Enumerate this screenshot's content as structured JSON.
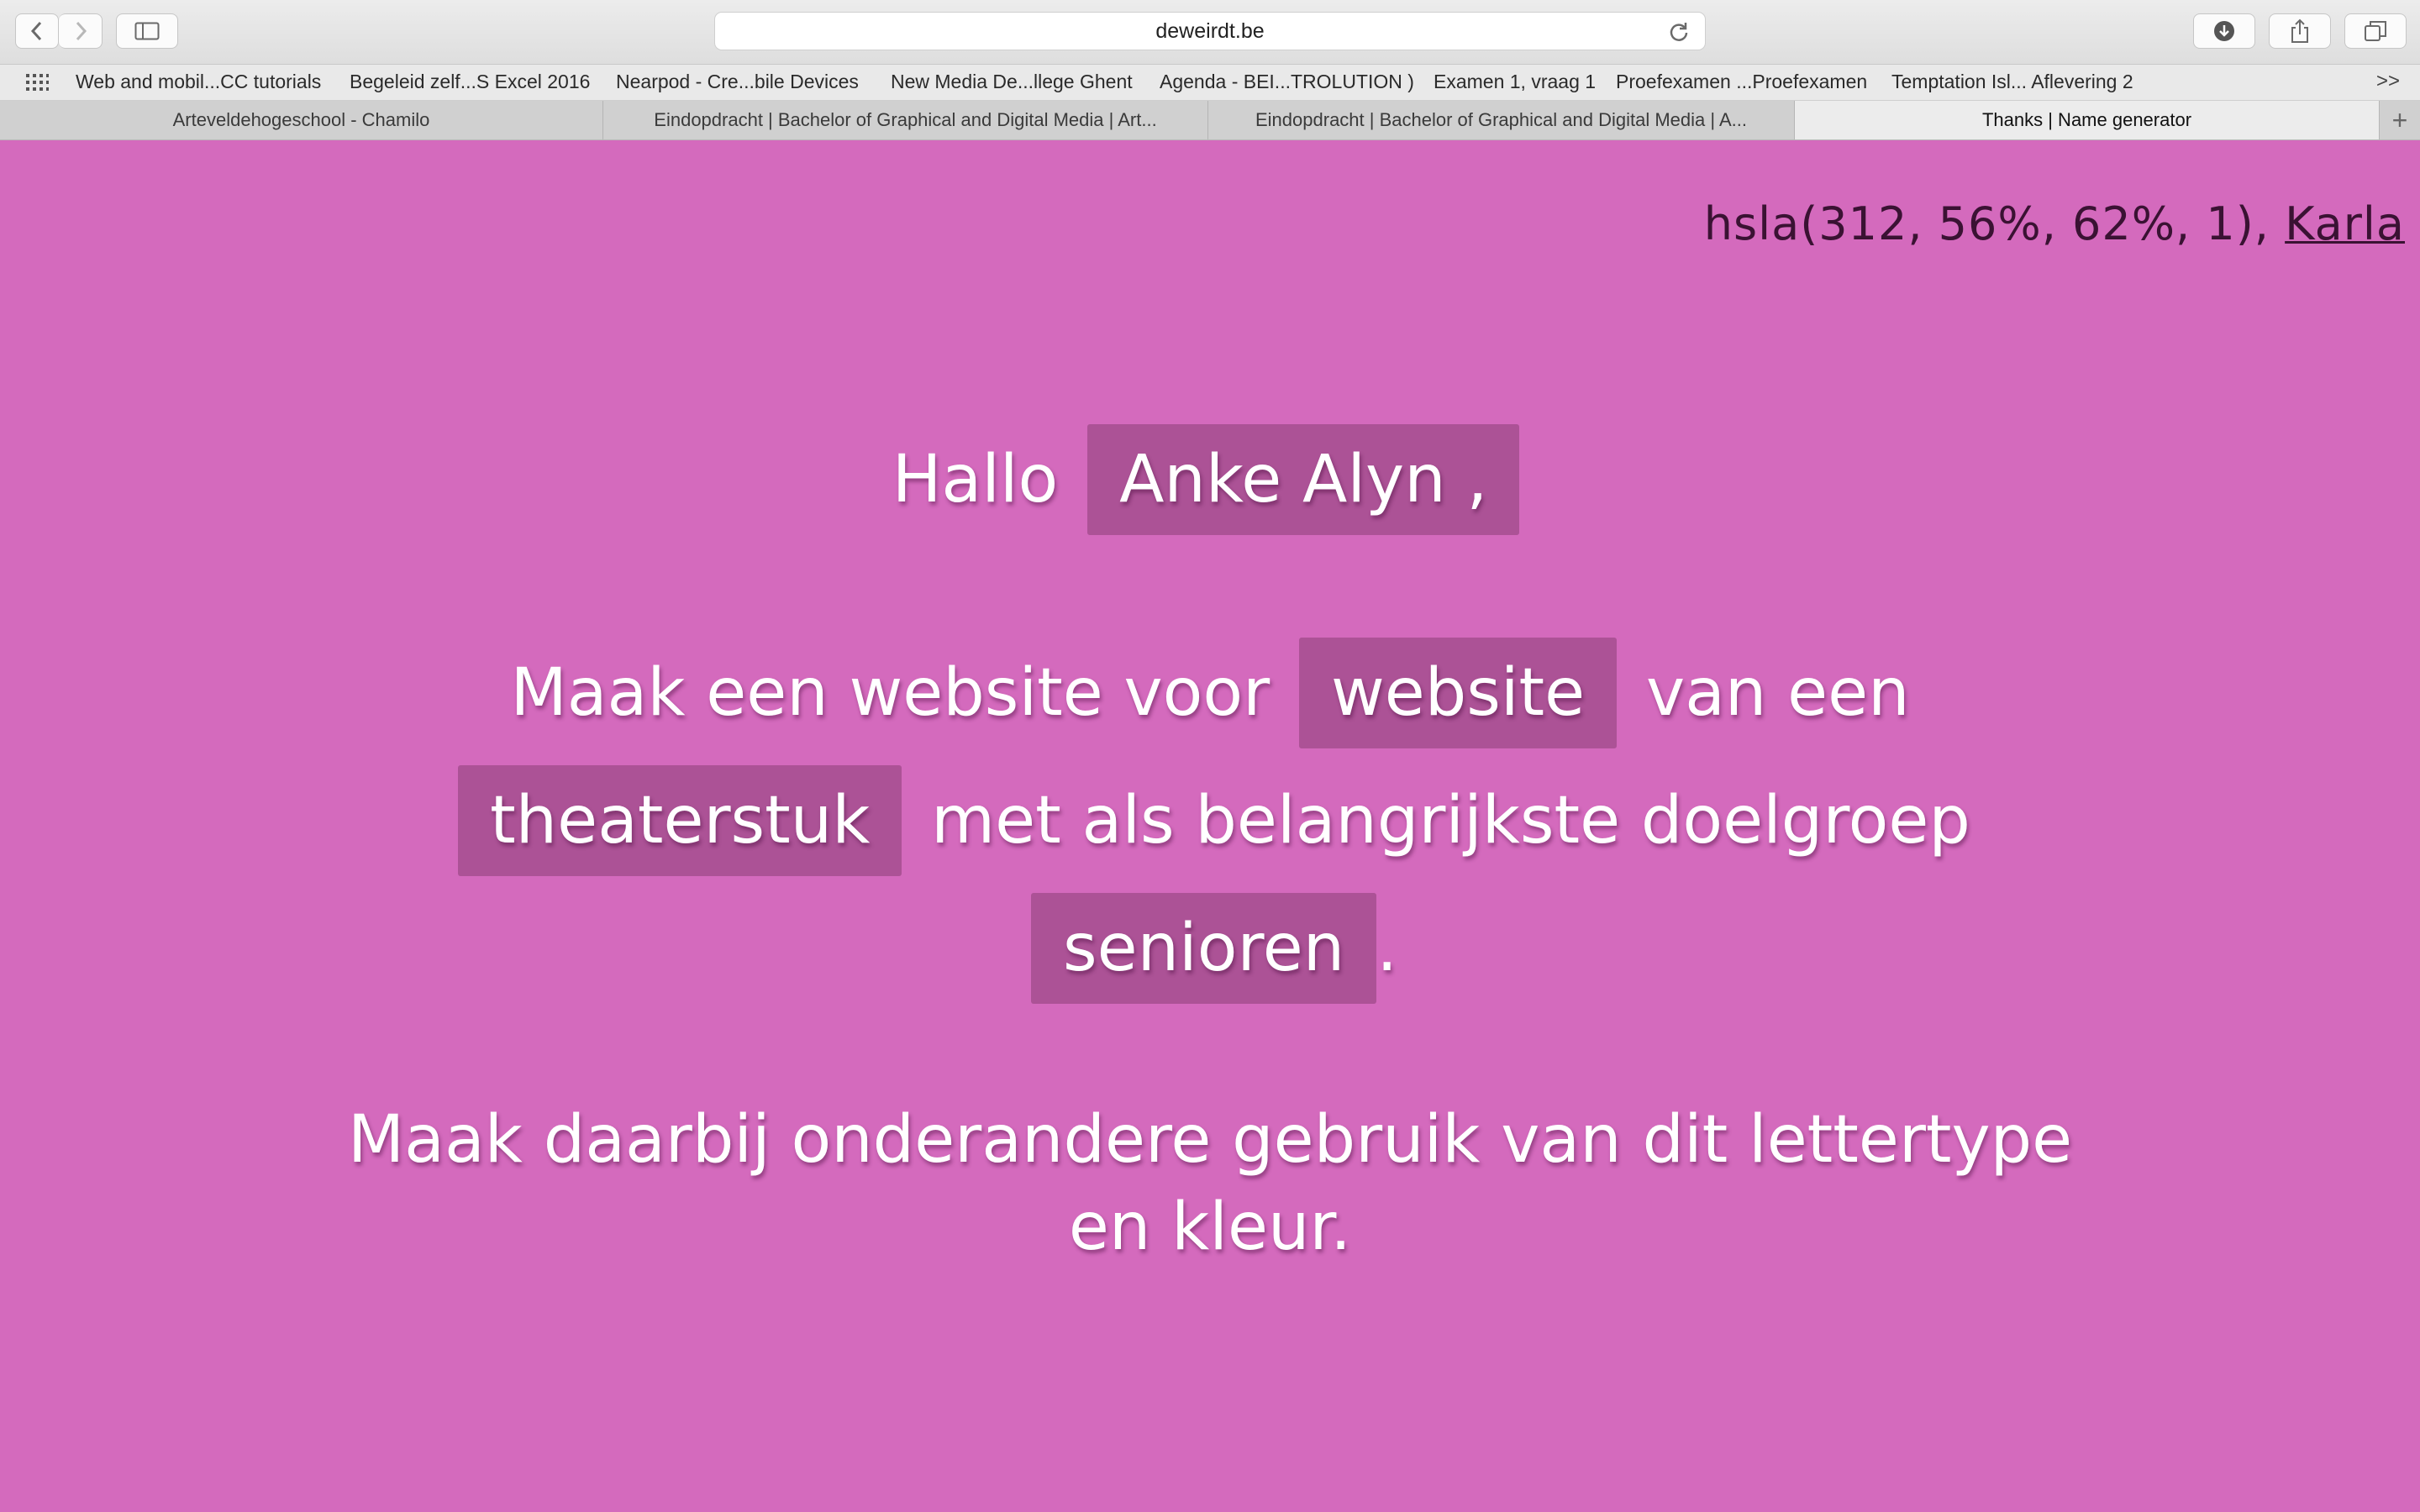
{
  "browser": {
    "url": "deweirdt.be",
    "bookmarks": [
      "Web and mobil...CC tutorials",
      "Begeleid zelf...S Excel 2016",
      "Nearpod - Cre...bile Devices",
      "New Media De...llege Ghent",
      "Agenda - BEI...TROLUTION )",
      "Examen 1, vraag 1",
      "Proefexamen ...Proefexamen",
      "Temptation Isl... Aflevering 2"
    ],
    "bookmarks_more": ">>",
    "tabs": [
      "Arteveldehogeschool - Chamilo",
      "Eindopdracht | Bachelor of Graphical and Digital Media | Art...",
      "Eindopdracht | Bachelor of Graphical and Digital Media | A...",
      "Thanks | Name generator"
    ],
    "new_tab": "+"
  },
  "page": {
    "background_color": "#d46abd",
    "chip_color": "#ac5296",
    "meta": {
      "color_text": "hsla(312, 56%, 62%, 1),",
      "font_link": "Karla"
    },
    "greeting": {
      "prefix": "Hallo",
      "name": "Anke Alyn ,"
    },
    "assignment": {
      "part1": "Maak een website voor",
      "type": "website",
      "part2": "van een",
      "subject": "theaterstuk",
      "part3": "met als belangrijkste doelgroep",
      "audience": "senioren",
      "end": "."
    },
    "closing": {
      "line1": "Maak daarbij onderandere gebruik van dit lettertype",
      "line2": "en kleur."
    }
  }
}
